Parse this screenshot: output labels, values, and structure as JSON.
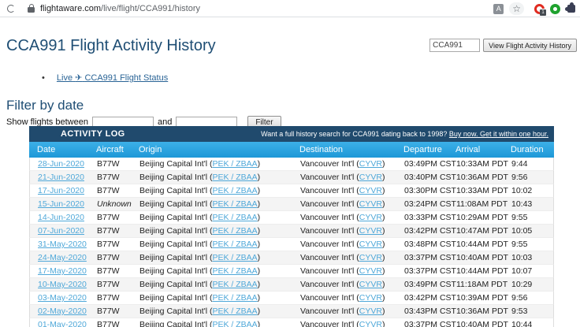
{
  "browser": {
    "url_domain": "flightaware.com",
    "url_path": "/live/flight/CCA991/history",
    "extension_badge_count": "1",
    "translate_icon_letter": "A",
    "star_glyph": "☆"
  },
  "header": {
    "title": "CCA991 Flight Activity History",
    "flight_input_value": "CCA991",
    "view_button_label": "View Flight Activity History"
  },
  "live_link": {
    "bullet": "•",
    "prefix": "Live",
    "plane_glyph": "✈",
    "suffix": "CCA991 Flight Status",
    "full": "Live ✈ CCA991 Flight Status"
  },
  "filter": {
    "heading": "Filter by date",
    "label": "Show flights between",
    "and_label": "and",
    "button_label": "Filter",
    "start_value": "",
    "end_value": ""
  },
  "activity_log": {
    "title": "ACTIVITY LOG",
    "promo_text": "Want a full history search for CCA991 dating back to 1998?",
    "promo_link": "Buy now. Get it within one hour.",
    "columns": [
      "Date",
      "Aircraft",
      "Origin",
      "Destination",
      "Departure",
      "Arrival",
      "Duration"
    ],
    "colors": {
      "navy_bar": "#204a6d",
      "column_bar": "#2aa0dc",
      "link_blue": "#4fa8d9",
      "alt_row": "#f4f4f4"
    },
    "rows": [
      {
        "date": "28-Jun-2020",
        "aircraft": "B77W",
        "origin_name": "Beijing Capital Int'l",
        "origin_code": "PEK / ZBAA",
        "destination_name": "Vancouver Int'l",
        "destination_code": "CYVR",
        "departure": "03:49PM CST",
        "arrival": "10:33AM PDT",
        "duration": "9:44"
      },
      {
        "date": "21-Jun-2020",
        "aircraft": "B77W",
        "origin_name": "Beijing Capital Int'l",
        "origin_code": "PEK / ZBAA",
        "destination_name": "Vancouver Int'l",
        "destination_code": "CYVR",
        "departure": "03:40PM CST",
        "arrival": "10:36AM PDT",
        "duration": "9:56"
      },
      {
        "date": "17-Jun-2020",
        "aircraft": "B77W",
        "origin_name": "Beijing Capital Int'l",
        "origin_code": "PEK / ZBAA",
        "destination_name": "Vancouver Int'l",
        "destination_code": "CYVR",
        "departure": "03:30PM CST",
        "arrival": "10:33AM PDT",
        "duration": "10:02"
      },
      {
        "date": "15-Jun-2020",
        "aircraft": "Unknown",
        "origin_name": "Beijing Capital Int'l",
        "origin_code": "PEK / ZBAA",
        "destination_name": "Vancouver Int'l",
        "destination_code": "CYVR",
        "departure": "03:24PM CST",
        "arrival": "11:08AM PDT",
        "duration": "10:43"
      },
      {
        "date": "14-Jun-2020",
        "aircraft": "B77W",
        "origin_name": "Beijing Capital Int'l",
        "origin_code": "PEK / ZBAA",
        "destination_name": "Vancouver Int'l",
        "destination_code": "CYVR",
        "departure": "03:33PM CST",
        "arrival": "10:29AM PDT",
        "duration": "9:55"
      },
      {
        "date": "07-Jun-2020",
        "aircraft": "B77W",
        "origin_name": "Beijing Capital Int'l",
        "origin_code": "PEK / ZBAA",
        "destination_name": "Vancouver Int'l",
        "destination_code": "CYVR",
        "departure": "03:42PM CST",
        "arrival": "10:47AM PDT",
        "duration": "10:05"
      },
      {
        "date": "31-May-2020",
        "aircraft": "B77W",
        "origin_name": "Beijing Capital Int'l",
        "origin_code": "PEK / ZBAA",
        "destination_name": "Vancouver Int'l",
        "destination_code": "CYVR",
        "departure": "03:48PM CST",
        "arrival": "10:44AM PDT",
        "duration": "9:55"
      },
      {
        "date": "24-May-2020",
        "aircraft": "B77W",
        "origin_name": "Beijing Capital Int'l",
        "origin_code": "PEK / ZBAA",
        "destination_name": "Vancouver Int'l",
        "destination_code": "CYVR",
        "departure": "03:37PM CST",
        "arrival": "10:40AM PDT",
        "duration": "10:03"
      },
      {
        "date": "17-May-2020",
        "aircraft": "B77W",
        "origin_name": "Beijing Capital Int'l",
        "origin_code": "PEK / ZBAA",
        "destination_name": "Vancouver Int'l",
        "destination_code": "CYVR",
        "departure": "03:37PM CST",
        "arrival": "10:44AM PDT",
        "duration": "10:07"
      },
      {
        "date": "10-May-2020",
        "aircraft": "B77W",
        "origin_name": "Beijing Capital Int'l",
        "origin_code": "PEK / ZBAA",
        "destination_name": "Vancouver Int'l",
        "destination_code": "CYVR",
        "departure": "03:49PM CST",
        "arrival": "11:18AM PDT",
        "duration": "10:29"
      },
      {
        "date": "03-May-2020",
        "aircraft": "B77W",
        "origin_name": "Beijing Capital Int'l",
        "origin_code": "PEK / ZBAA",
        "destination_name": "Vancouver Int'l",
        "destination_code": "CYVR",
        "departure": "03:42PM CST",
        "arrival": "10:39AM PDT",
        "duration": "9:56"
      },
      {
        "date": "02-May-2020",
        "aircraft": "B77W",
        "origin_name": "Beijing Capital Int'l",
        "origin_code": "PEK / ZBAA",
        "destination_name": "Vancouver Int'l",
        "destination_code": "CYVR",
        "departure": "03:43PM CST",
        "arrival": "10:36AM PDT",
        "duration": "9:53"
      },
      {
        "date": "01-May-2020",
        "aircraft": "B77W",
        "origin_name": "Beijing Capital Int'l",
        "origin_code": "PEK / ZBAA",
        "destination_name": "Vancouver Int'l",
        "destination_code": "CYVR",
        "departure": "03:37PM CST",
        "arrival": "10:40AM PDT",
        "duration": "10:44"
      }
    ]
  }
}
